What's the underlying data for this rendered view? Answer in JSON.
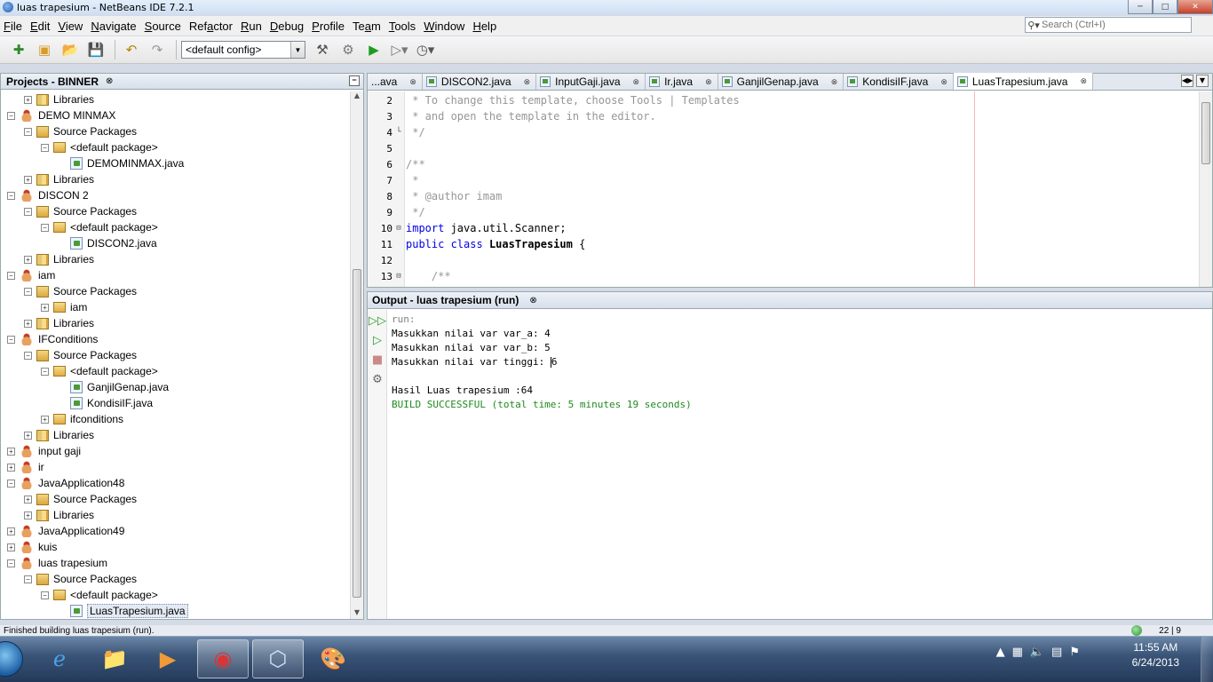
{
  "window": {
    "title": "luas trapesium - NetBeans IDE 7.2.1"
  },
  "menu": [
    {
      "label": "File",
      "mn": "F",
      "rest": "ile"
    },
    {
      "label": "Edit",
      "mn": "E",
      "rest": "dit"
    },
    {
      "label": "View",
      "mn": "V",
      "rest": "iew"
    },
    {
      "label": "Navigate",
      "mn": "N",
      "rest": "avigate"
    },
    {
      "label": "Source",
      "mn": "S",
      "rest": "ource"
    },
    {
      "label": "Refactor",
      "mn": "R",
      "rest": "efactor",
      "prefix": "Ref",
      "under": "a",
      "suffix": "ctor"
    },
    {
      "label": "Run",
      "mn": "R",
      "rest": "un"
    },
    {
      "label": "Debug",
      "mn": "D",
      "rest": "ebug"
    },
    {
      "label": "Profile",
      "mn": "P",
      "rest": "rofile"
    },
    {
      "label": "Team",
      "mn": "T",
      "rest": "eam",
      "prefix": "Te",
      "under": "a",
      "suffix": "m"
    },
    {
      "label": "Tools",
      "mn": "T",
      "rest": "ools"
    },
    {
      "label": "Window",
      "mn": "W",
      "rest": "indow"
    },
    {
      "label": "Help",
      "mn": "H",
      "rest": "elp"
    }
  ],
  "search": {
    "placeholder": "Search (Ctrl+I)"
  },
  "toolbar": {
    "config": "<default config>"
  },
  "projects": {
    "title": "Projects - BINNER",
    "tree": [
      {
        "depth": 1,
        "exp": "+",
        "icon": "libs",
        "label": "Libraries"
      },
      {
        "depth": 0,
        "exp": "-",
        "icon": "project",
        "label": "DEMO MINMAX"
      },
      {
        "depth": 1,
        "exp": "-",
        "icon": "srcpkg",
        "label": "Source Packages"
      },
      {
        "depth": 2,
        "exp": "-",
        "icon": "pkg",
        "label": "<default package>"
      },
      {
        "depth": 3,
        "exp": "",
        "icon": "java",
        "label": "DEMOMINMAX.java"
      },
      {
        "depth": 1,
        "exp": "+",
        "icon": "libs",
        "label": "Libraries"
      },
      {
        "depth": 0,
        "exp": "-",
        "icon": "project",
        "label": "DISCON 2"
      },
      {
        "depth": 1,
        "exp": "-",
        "icon": "srcpkg",
        "label": "Source Packages"
      },
      {
        "depth": 2,
        "exp": "-",
        "icon": "pkg",
        "label": "<default package>"
      },
      {
        "depth": 3,
        "exp": "",
        "icon": "java",
        "label": "DISCON2.java"
      },
      {
        "depth": 1,
        "exp": "+",
        "icon": "libs",
        "label": "Libraries"
      },
      {
        "depth": 0,
        "exp": "-",
        "icon": "project",
        "label": "iam"
      },
      {
        "depth": 1,
        "exp": "-",
        "icon": "srcpkg",
        "label": "Source Packages"
      },
      {
        "depth": 2,
        "exp": "+",
        "icon": "pkg",
        "label": "iam"
      },
      {
        "depth": 1,
        "exp": "+",
        "icon": "libs",
        "label": "Libraries"
      },
      {
        "depth": 0,
        "exp": "-",
        "icon": "project",
        "label": "IFConditions"
      },
      {
        "depth": 1,
        "exp": "-",
        "icon": "srcpkg",
        "label": "Source Packages"
      },
      {
        "depth": 2,
        "exp": "-",
        "icon": "pkg",
        "label": "<default package>"
      },
      {
        "depth": 3,
        "exp": "",
        "icon": "java",
        "label": "GanjilGenap.java"
      },
      {
        "depth": 3,
        "exp": "",
        "icon": "java",
        "label": "KondisiIF.java"
      },
      {
        "depth": 2,
        "exp": "+",
        "icon": "pkg",
        "label": "ifconditions"
      },
      {
        "depth": 1,
        "exp": "+",
        "icon": "libs",
        "label": "Libraries"
      },
      {
        "depth": 0,
        "exp": "+",
        "icon": "project",
        "label": "input gaji"
      },
      {
        "depth": 0,
        "exp": "+",
        "icon": "project",
        "label": "ir"
      },
      {
        "depth": 0,
        "exp": "-",
        "icon": "project",
        "label": "JavaApplication48"
      },
      {
        "depth": 1,
        "exp": "+",
        "icon": "srcpkg",
        "label": "Source Packages"
      },
      {
        "depth": 1,
        "exp": "+",
        "icon": "libs",
        "label": "Libraries"
      },
      {
        "depth": 0,
        "exp": "+",
        "icon": "project",
        "label": "JavaApplication49"
      },
      {
        "depth": 0,
        "exp": "+",
        "icon": "project",
        "label": "kuis"
      },
      {
        "depth": 0,
        "exp": "-",
        "icon": "project",
        "label": "luas trapesium"
      },
      {
        "depth": 1,
        "exp": "-",
        "icon": "srcpkg",
        "label": "Source Packages"
      },
      {
        "depth": 2,
        "exp": "-",
        "icon": "pkg",
        "label": "<default package>"
      },
      {
        "depth": 3,
        "exp": "",
        "icon": "java",
        "label": "LuasTrapesium.java",
        "selected": true
      }
    ]
  },
  "editor": {
    "tabs": [
      {
        "label": "...ava",
        "icon": false,
        "active": false
      },
      {
        "label": "DISCON2.java",
        "icon": true,
        "active": false
      },
      {
        "label": "InputGaji.java",
        "icon": true,
        "active": false
      },
      {
        "label": "Ir.java",
        "icon": true,
        "active": false
      },
      {
        "label": "GanjilGenap.java",
        "icon": true,
        "active": false
      },
      {
        "label": "KondisiIF.java",
        "icon": true,
        "active": false
      },
      {
        "label": "LuasTrapesium.java",
        "icon": true,
        "active": true
      }
    ],
    "lines": [
      {
        "n": "2",
        "fold": "",
        "parts": [
          {
            "c": "cmt",
            "t": " * To change this template, choose Tools | Templates"
          }
        ]
      },
      {
        "n": "3",
        "fold": "",
        "parts": [
          {
            "c": "cmt",
            "t": " * and open the template in the editor."
          }
        ]
      },
      {
        "n": "4",
        "fold": "└",
        "parts": [
          {
            "c": "cmt",
            "t": " */"
          }
        ]
      },
      {
        "n": "5",
        "fold": "",
        "parts": []
      },
      {
        "n": "6",
        "fold": "",
        "parts": [
          {
            "c": "cmt",
            "t": "/**"
          }
        ]
      },
      {
        "n": "7",
        "fold": "",
        "parts": [
          {
            "c": "cmt",
            "t": " *"
          }
        ]
      },
      {
        "n": "8",
        "fold": "",
        "parts": [
          {
            "c": "cmt",
            "t": " * @author imam"
          }
        ]
      },
      {
        "n": "9",
        "fold": "",
        "parts": [
          {
            "c": "cmt",
            "t": " */"
          }
        ]
      },
      {
        "n": "10",
        "fold": "⊟",
        "parts": [
          {
            "c": "kw",
            "t": "import"
          },
          {
            "c": "",
            "t": " java.util.Scanner;"
          }
        ]
      },
      {
        "n": "11",
        "fold": "",
        "parts": [
          {
            "c": "kw",
            "t": "public class"
          },
          {
            "c": "",
            "t": " "
          },
          {
            "c": "cls",
            "t": "LuasTrapesium"
          },
          {
            "c": "",
            "t": " {"
          }
        ]
      },
      {
        "n": "12",
        "fold": "",
        "parts": []
      },
      {
        "n": "13",
        "fold": "⊟",
        "parts": [
          {
            "c": "cmt",
            "t": "    /**"
          }
        ]
      }
    ]
  },
  "output": {
    "title": "Output - luas trapesium (run)",
    "lines": [
      {
        "c": "muted",
        "t": "run:"
      },
      {
        "c": "",
        "t": "Masukkan nilai var var_a: 4"
      },
      {
        "c": "",
        "t": "Masukkan nilai var var_b: 5"
      },
      {
        "c": "",
        "t": "Masukkan nilai var tinggi: ",
        "cursor": true,
        "after": "6"
      },
      {
        "c": "",
        "t": ""
      },
      {
        "c": "",
        "t": "Hasil Luas trapesium :64"
      },
      {
        "c": "success",
        "t": "BUILD SUCCESSFUL (total time: 5 minutes 19 seconds)"
      }
    ]
  },
  "status": {
    "message": "Finished building luas trapesium (run).",
    "position": "22 | 9"
  },
  "taskbar": {
    "time": "11:55 AM",
    "date": "6/24/2013"
  },
  "colors": {
    "keyword": "#0000e6",
    "comment": "#969696",
    "success": "#1e8a1e"
  }
}
